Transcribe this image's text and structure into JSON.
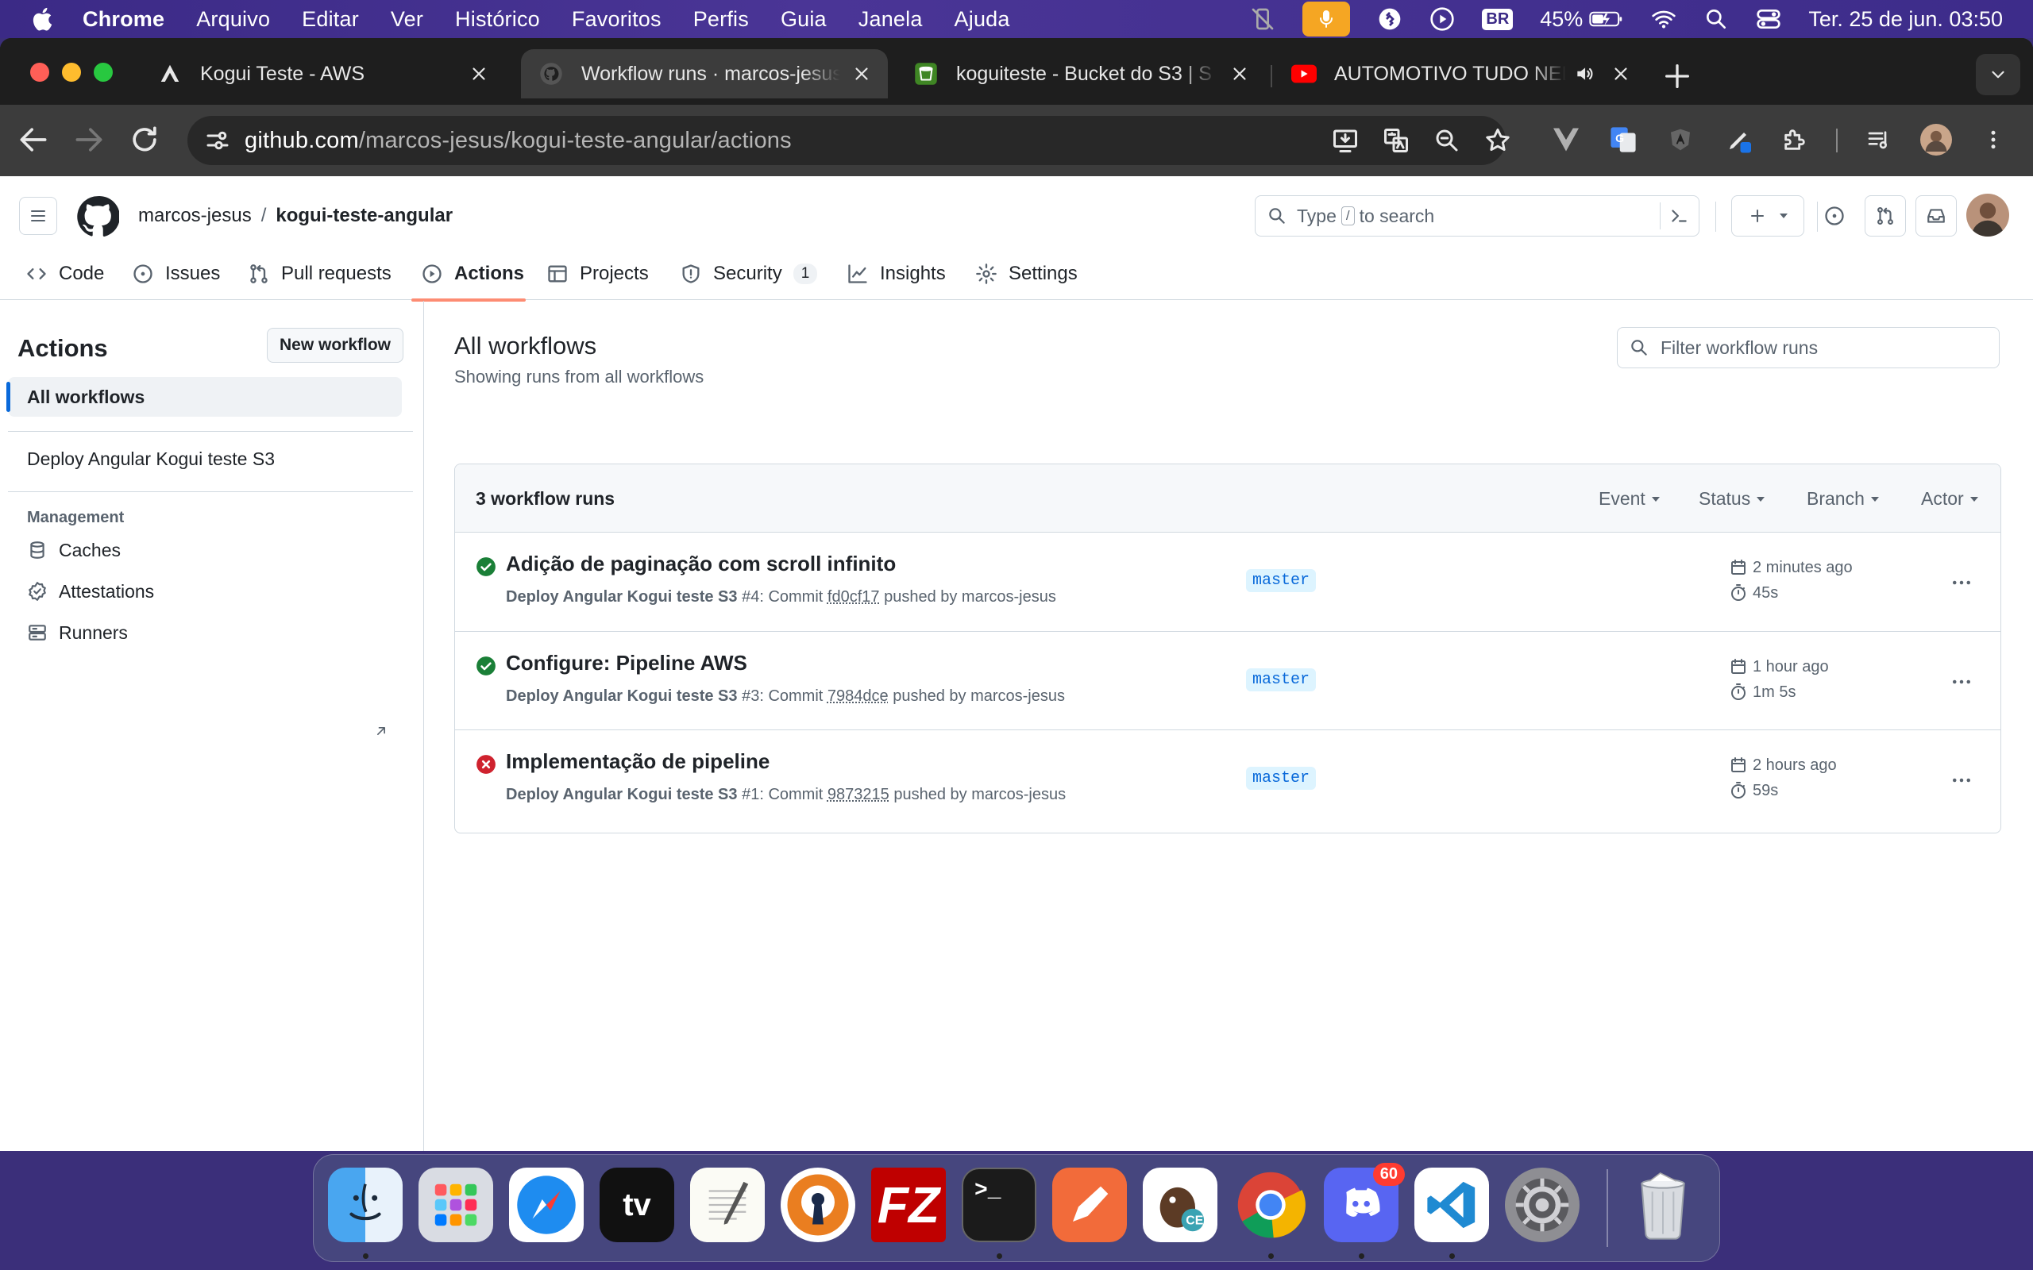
{
  "menubar": {
    "app_name": "Chrome",
    "menus": [
      "Arquivo",
      "Editar",
      "Ver",
      "Histórico",
      "Favoritos",
      "Perfis",
      "Guia",
      "Janela",
      "Ajuda"
    ],
    "input_badge": "BR",
    "battery": "45%",
    "clock": "Ter. 25 de jun.  03:50"
  },
  "browser": {
    "tabs": [
      {
        "title": "Kogui Teste - AWS",
        "icon": "aws-amplify-icon"
      },
      {
        "title": "Workflow runs · marcos-jesus",
        "icon": "github-icon"
      },
      {
        "title": "koguiteste - Bucket do S3 | S",
        "icon": "s3-bucket-icon"
      },
      {
        "title": "AUTOMOTIVO TUDO NEL",
        "icon": "youtube-icon"
      }
    ],
    "url_host": "github.com",
    "url_path": "/marcos-jesus/kogui-teste-angular/actions"
  },
  "github": {
    "owner": "marcos-jesus",
    "repo": "kogui-teste-angular",
    "search_prefix": "Type",
    "search_key": "/",
    "search_suffix": "to search",
    "nav": [
      {
        "label": "Code",
        "icon": "code-icon"
      },
      {
        "label": "Issues",
        "icon": "issue-opened-icon"
      },
      {
        "label": "Pull requests",
        "icon": "git-pull-request-icon"
      },
      {
        "label": "Actions",
        "icon": "play-icon"
      },
      {
        "label": "Projects",
        "icon": "table-icon"
      },
      {
        "label": "Security",
        "icon": "shield-icon",
        "count": "1"
      },
      {
        "label": "Insights",
        "icon": "graph-icon"
      },
      {
        "label": "Settings",
        "icon": "gear-icon"
      }
    ],
    "sidebar": {
      "title": "Actions",
      "new_workflow": "New workflow",
      "all_workflows": "All workflows",
      "workflows": [
        "Deploy Angular Kogui teste S3"
      ],
      "management_heading": "Management",
      "management": [
        "Caches",
        "Attestations",
        "Runners"
      ]
    },
    "main": {
      "title": "All workflows",
      "subtitle": "Showing runs from all workflows",
      "filter_placeholder": "Filter workflow runs",
      "runs_count": "3 workflow runs",
      "filters": [
        "Event",
        "Status",
        "Branch",
        "Actor"
      ],
      "runs": [
        {
          "title": "Adição de paginação com scroll infinito",
          "status": "success",
          "workflow": "Deploy Angular Kogui teste S3",
          "run_number": "#4",
          "commit_label": ": Commit",
          "sha": "fd0cf17",
          "pushed_by": "pushed by marcos-jesus",
          "branch": "master",
          "when": "2 minutes ago",
          "duration": "45s"
        },
        {
          "title": "Configure: Pipeline AWS",
          "status": "success",
          "workflow": "Deploy Angular Kogui teste S3",
          "run_number": "#3",
          "commit_label": ": Commit",
          "sha": "7984dce",
          "pushed_by": "pushed by marcos-jesus",
          "branch": "master",
          "when": "1 hour ago",
          "duration": "1m 5s"
        },
        {
          "title": "Implementação de pipeline",
          "status": "failure",
          "workflow": "Deploy Angular Kogui teste S3",
          "run_number": "#1",
          "commit_label": ": Commit",
          "sha": "9873215",
          "pushed_by": "pushed by marcos-jesus",
          "branch": "master",
          "when": "2 hours ago",
          "duration": "59s"
        }
      ]
    }
  },
  "dock": {
    "apps": [
      "Finder",
      "Launchpad",
      "Safari",
      "Apple TV",
      "TextEdit",
      "OpenVPN Connect",
      "FileZilla",
      "Terminal",
      "Postman",
      "DBeaver",
      "Google Chrome",
      "Discord",
      "Visual Studio Code",
      "System Settings"
    ],
    "discord_badge": "60",
    "trash": "Trash"
  },
  "colors": {
    "success": "#1a7f37",
    "failure": "#cf222e",
    "accent": "#0969da",
    "nav_underline": "#fd8c73"
  }
}
